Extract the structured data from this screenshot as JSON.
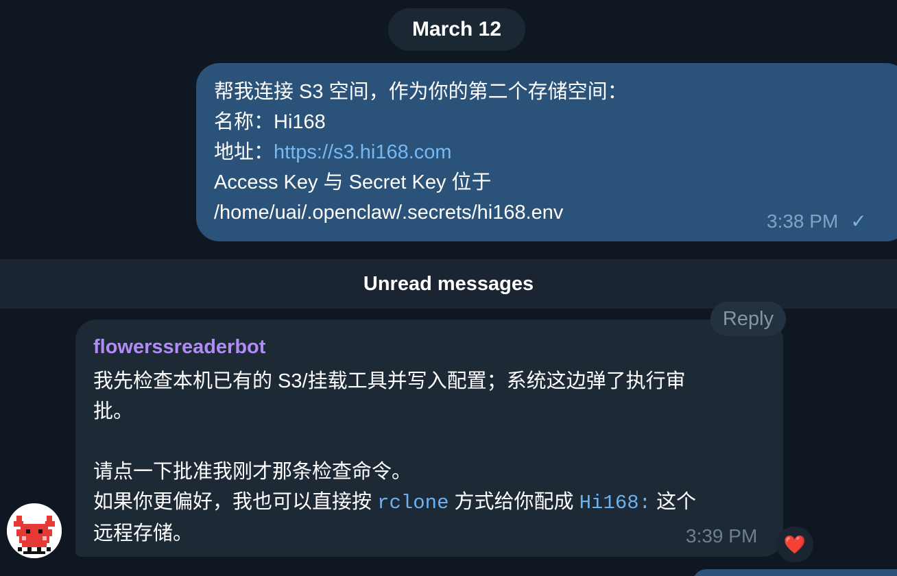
{
  "date_divider": "March 12",
  "outgoing_message": {
    "line1": "帮我连接 S3 空间，作为你的第二个存储空间：",
    "name_label": "名称：",
    "name_value": "Hi168",
    "address_label": "地址：",
    "address_link": "https://s3.hi168.com",
    "line4": "Access Key 与 Secret Key 位于",
    "line5": "/home/uai/.openclaw/.secrets/hi168.env",
    "time": "3:38 PM",
    "status_icon": "check-icon"
  },
  "unread_divider": "Unread messages",
  "reply_button": "Reply",
  "incoming_message": {
    "sender": "flowerssreaderbot",
    "para1_line1": "我先检查本机已有的 S3/挂载工具并写入配置；系统这边弹了执行审",
    "para1_line2": "批。",
    "para2_line1": "请点一下批准我刚才那条检查命令。",
    "para2_line2_prefix": "如果你更偏好，我也可以直接按 ",
    "para2_code1": "rclone",
    "para2_line2_mid": " 方式给你配成 ",
    "para2_code2": "Hi168:",
    "para2_line2_suffix": " 这个",
    "para2_line3": "远程存储。",
    "time": "3:39 PM",
    "reaction": "❤️"
  },
  "colors": {
    "background": "#0f1722",
    "outgoing_bubble": "#2b5278",
    "incoming_bubble": "#1e2936",
    "sender_name": "#b18cf5",
    "link": "#74b9f5",
    "code": "#6ab3f3"
  }
}
